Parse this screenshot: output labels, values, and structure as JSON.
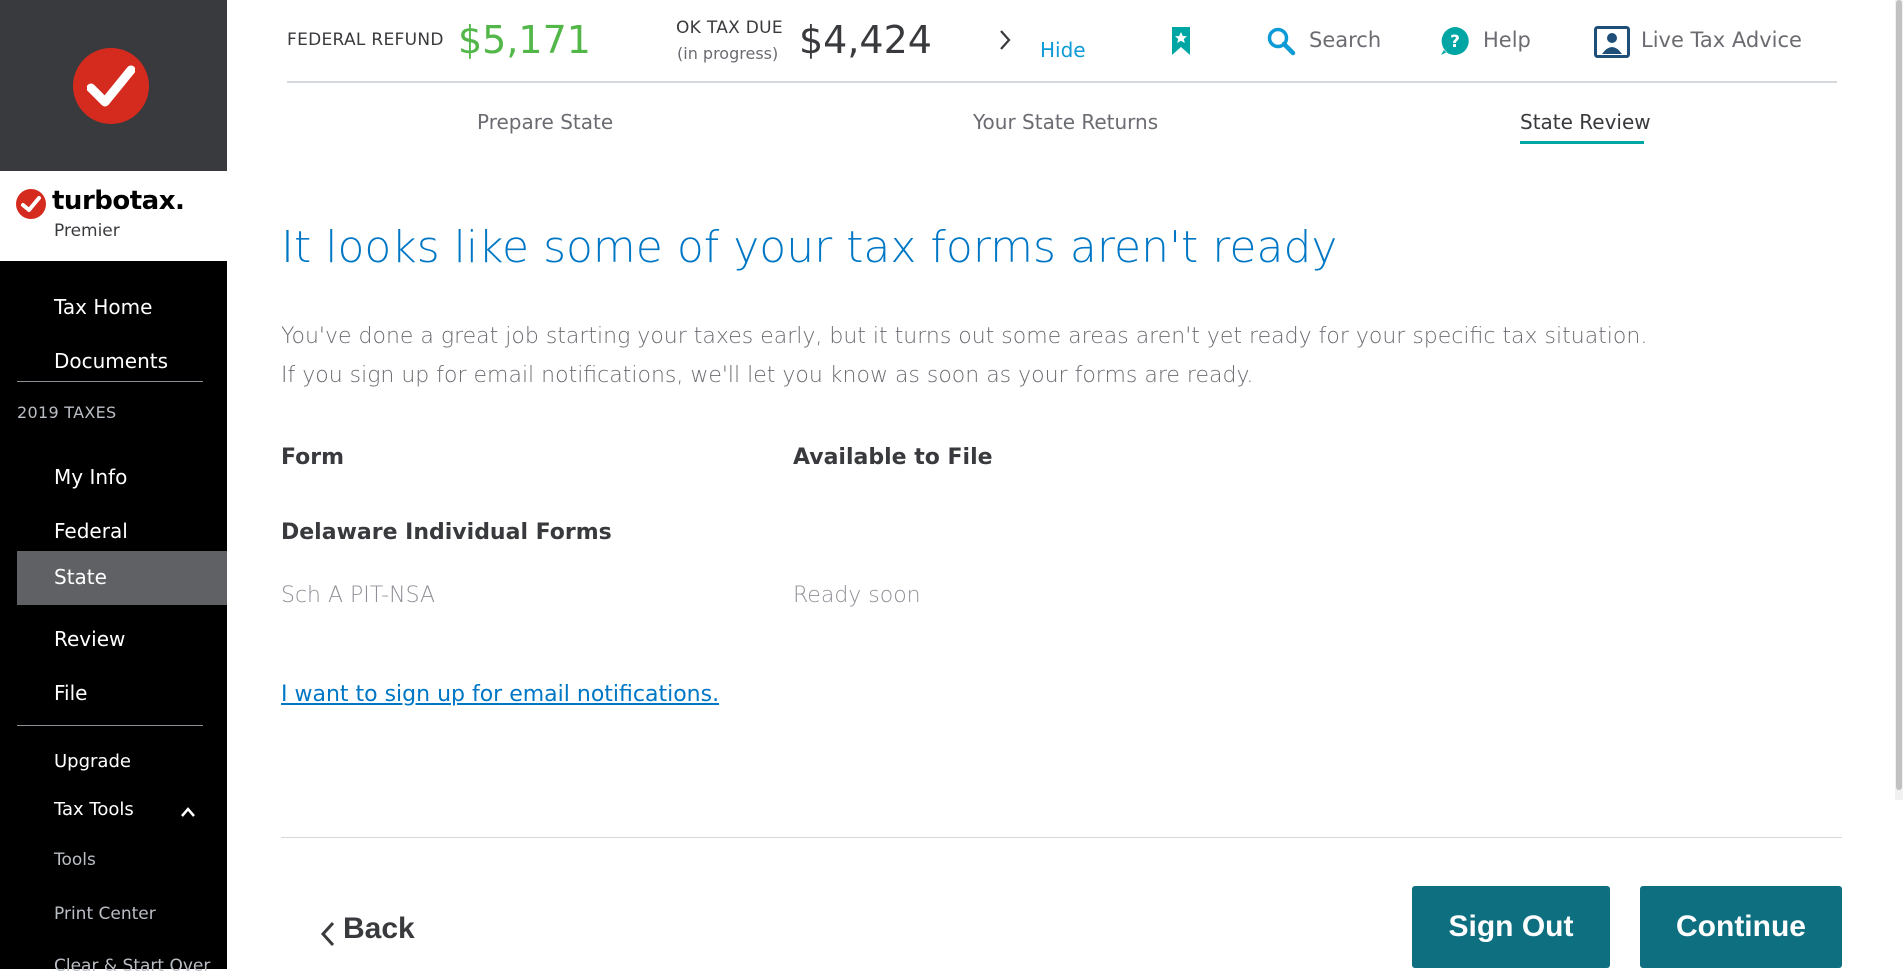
{
  "sidebar": {
    "brand_name": "turbotax",
    "brand_dot": ".",
    "brand_edition": "Premier",
    "nav_main": [
      "Tax Home",
      "Documents"
    ],
    "section_header": "2019 TAXES",
    "nav_taxes": [
      "My Info",
      "Federal",
      "State",
      "Review",
      "File"
    ],
    "active_item": "State",
    "upgrade": "Upgrade",
    "tax_tools": "Tax Tools",
    "tools": "Tools",
    "print_center": "Print Center",
    "clear_start_over": "Clear & Start Over"
  },
  "topbar": {
    "federal_refund_label": "FEDERAL REFUND",
    "federal_refund_amount": "$5,171",
    "ok_tax_due_label": "OK TAX DUE",
    "ok_tax_due_sub": "(in progress)",
    "ok_tax_due_amount": "$4,424",
    "hide_label": "Hide",
    "search_label": "Search",
    "help_label": "Help",
    "live_advice_label": "Live Tax Advice"
  },
  "steps": [
    "Prepare State",
    "Your State Returns",
    "State Review"
  ],
  "active_step": "State Review",
  "main": {
    "title": "It looks like some of your tax forms aren't ready",
    "intro_line1": "You've done a great job starting your taxes early, but it turns out some areas aren't yet ready for your specific tax situation.",
    "intro_line2": "If you sign up for email notifications, we'll let you know as soon as your forms are ready.",
    "table": {
      "headers": [
        "Form",
        "Available to File"
      ],
      "group": "Delaware Individual Forms",
      "rows": [
        {
          "form": "Sch A PIT-NSA",
          "status": "Ready soon"
        }
      ]
    },
    "email_link": "I want to sign up for email notifications."
  },
  "footer": {
    "back_label": "Back",
    "sign_out_label": "Sign Out",
    "continue_label": "Continue"
  },
  "colors": {
    "accent_blue": "#0077c5",
    "refund_green": "#52b748",
    "button_teal": "#0d6f80",
    "brand_red": "#d52b1e"
  }
}
